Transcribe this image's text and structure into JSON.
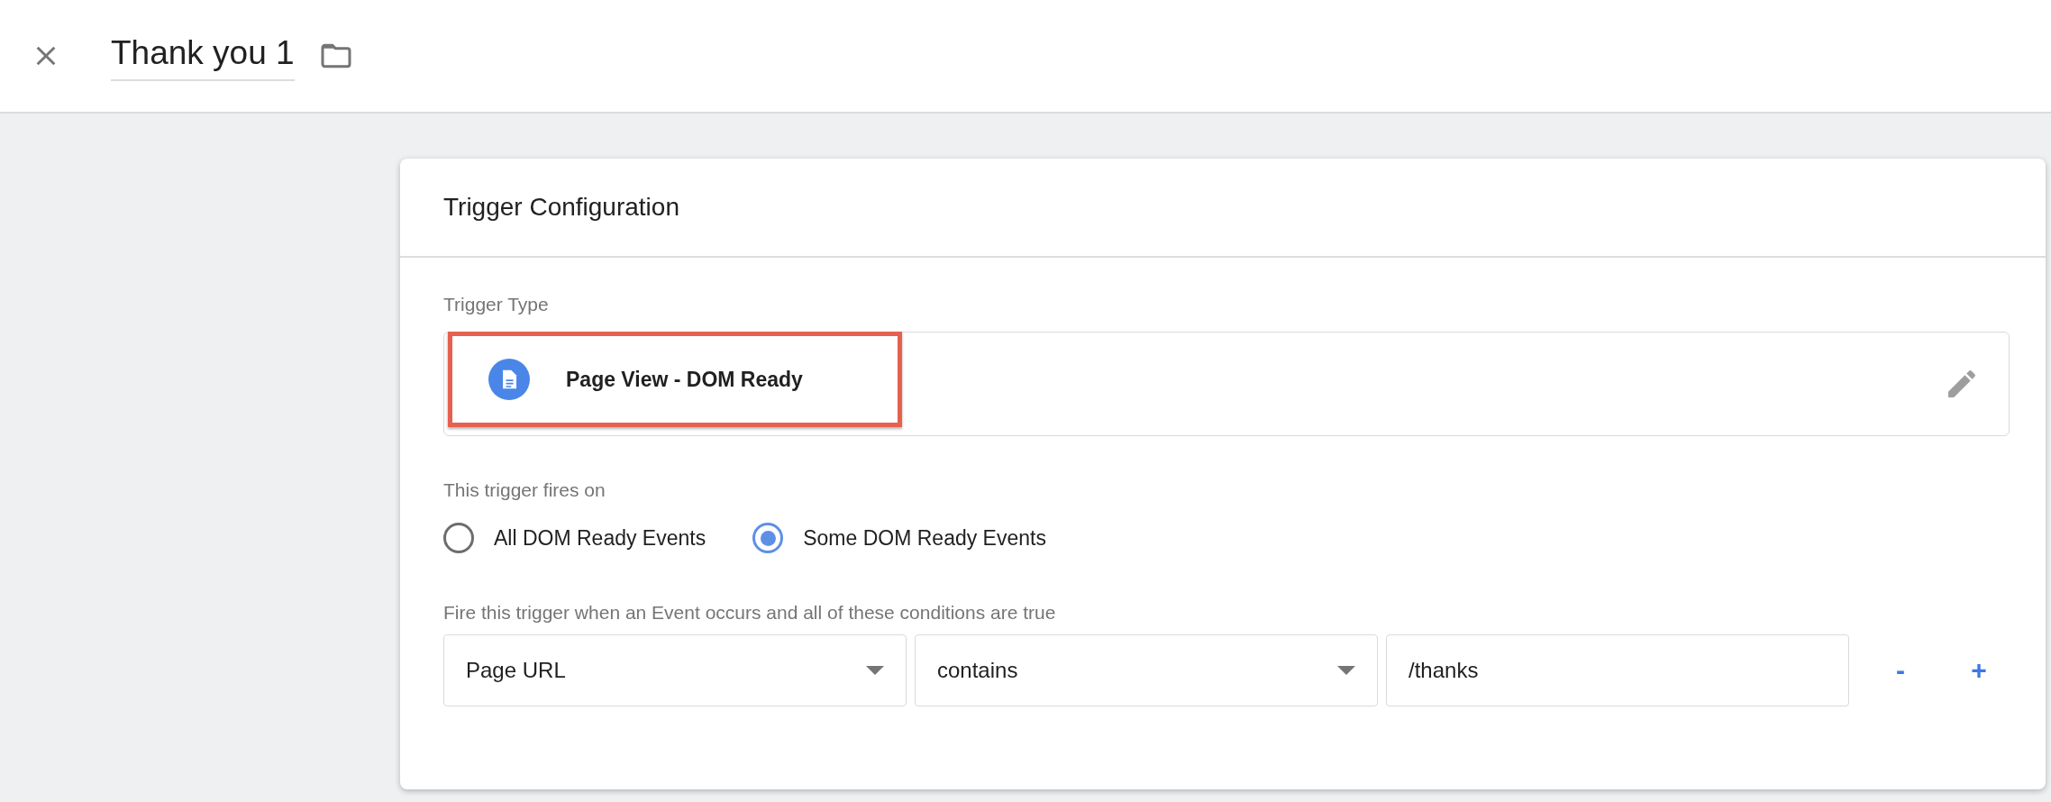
{
  "header": {
    "title": "Thank you 1"
  },
  "card": {
    "title": "Trigger Configuration",
    "trigger_type": {
      "label": "Trigger Type",
      "value": "Page View - DOM Ready",
      "highlighted": true
    },
    "fires_on": {
      "label": "This trigger fires on",
      "options": [
        {
          "label": "All DOM Ready Events",
          "selected": false
        },
        {
          "label": "Some DOM Ready Events",
          "selected": true
        }
      ]
    },
    "conditions": {
      "label": "Fire this trigger when an Event occurs and all of these conditions are true",
      "rows": [
        {
          "variable": "Page URL",
          "operator": "contains",
          "value": "/thanks",
          "remove": "-",
          "add": "+"
        }
      ]
    }
  }
}
